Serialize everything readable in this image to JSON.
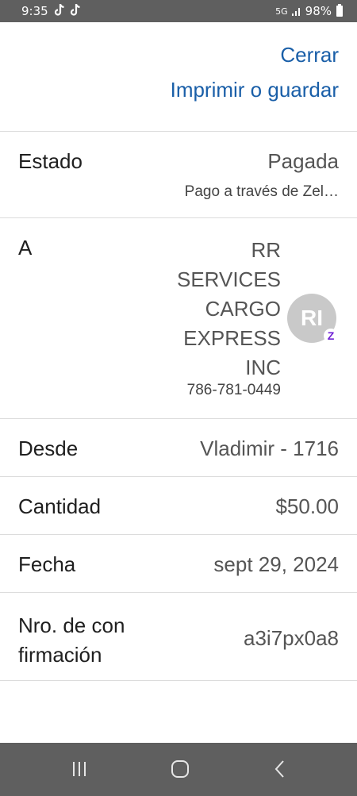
{
  "status_bar": {
    "time": "9:35",
    "battery": "98%",
    "icons": [
      "tiktok-icon",
      "tiktok-icon",
      "5g-icon",
      "signal-icon",
      "battery-icon"
    ]
  },
  "header": {
    "close_label": "Cerrar",
    "print_label": "Imprimir o guardar"
  },
  "details": {
    "status_label": "Estado",
    "status_value": "Pagada",
    "status_sub": "Pago a través de Zel…",
    "to_label": "A",
    "recipient_lines": [
      "RR",
      "SERVICES",
      "CARGO",
      "EXPRESS",
      "INC"
    ],
    "recipient_phone": "786-781-0449",
    "avatar_initials": "RI",
    "from_label": "Desde",
    "from_value": "Vladimir - 1716",
    "amount_label": "Cantidad",
    "amount_value": "$50.00",
    "date_label": "Fecha",
    "date_value": "sept 29, 2024",
    "conf_label_lines": [
      "Nro. de con",
      "firmación"
    ],
    "conf_value": "a3i7px0a8"
  },
  "colors": {
    "link": "#1a5fa8",
    "system_bar": "#5f5f5f",
    "zelle": "#6d1ed4"
  },
  "nav": {
    "icons": [
      "recent-apps-icon",
      "home-icon",
      "back-icon"
    ]
  }
}
